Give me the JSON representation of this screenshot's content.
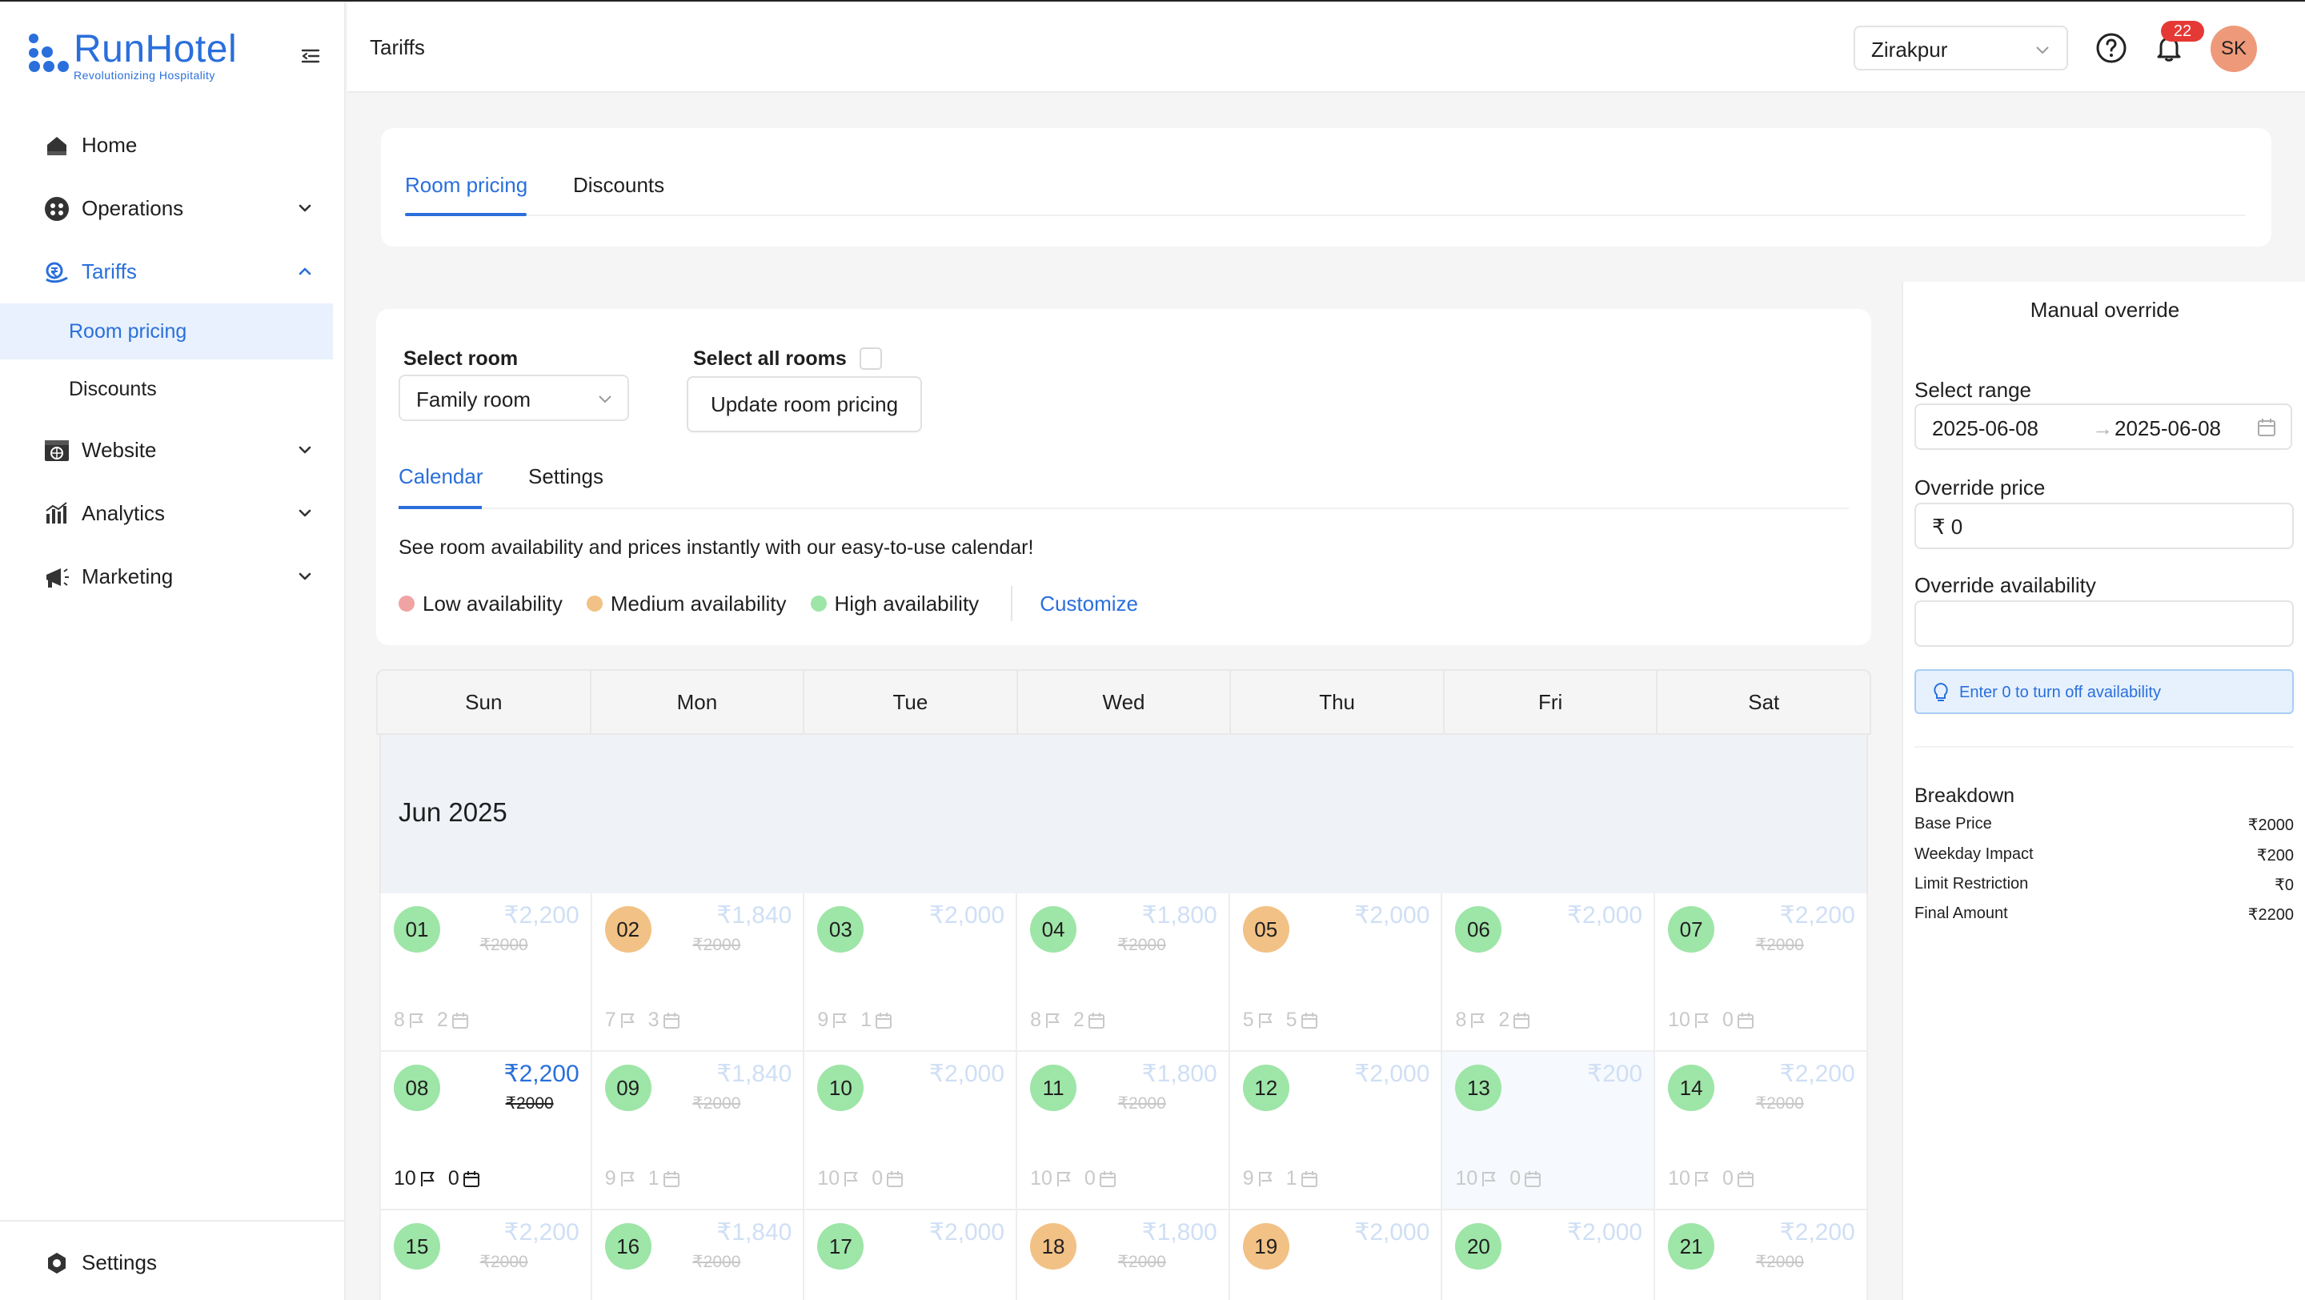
{
  "brand": {
    "name": "RunHotel",
    "tagline": "Revolutionizing Hospitality",
    "color": "#2a6fdb"
  },
  "sidebar": {
    "items": [
      {
        "label": "Home",
        "icon": "home-icon"
      },
      {
        "label": "Operations",
        "icon": "operations-icon",
        "expandable": true
      },
      {
        "label": "Tariffs",
        "icon": "tariffs-icon",
        "expanded": true,
        "active": true
      },
      {
        "label": "Website",
        "icon": "website-icon",
        "expandable": true
      },
      {
        "label": "Analytics",
        "icon": "analytics-icon",
        "expandable": true
      },
      {
        "label": "Marketing",
        "icon": "marketing-icon",
        "expandable": true
      }
    ],
    "sub_items": [
      {
        "label": "Room pricing",
        "selected": true
      },
      {
        "label": "Discounts"
      }
    ],
    "settings_label": "Settings"
  },
  "header": {
    "title": "Tariffs",
    "location": "Zirakpur",
    "notification_count": "22",
    "avatar_initials": "SK"
  },
  "main_tabs": [
    {
      "label": "Room pricing",
      "active": true
    },
    {
      "label": "Discounts"
    }
  ],
  "room": {
    "select_room_label": "Select room",
    "selected_room": "Family room",
    "select_all_label": "Select all rooms",
    "select_all_checked": false,
    "update_button": "Update room pricing",
    "tabs": [
      {
        "label": "Calendar",
        "active": true
      },
      {
        "label": "Settings"
      }
    ],
    "description": "See room availability and prices instantly with our easy-to-use calendar!",
    "legend": [
      {
        "label": "Low availability",
        "color": "#f0a3a3"
      },
      {
        "label": "Medium availability",
        "color": "#f2c185"
      },
      {
        "label": "High availability",
        "color": "#9ee5a8"
      }
    ],
    "customize_label": "Customize"
  },
  "calendar": {
    "weekdays": [
      "Sun",
      "Mon",
      "Tue",
      "Wed",
      "Thu",
      "Fri",
      "Sat"
    ],
    "month_label": "Jun 2025",
    "colors": {
      "green": "#9ee5a8",
      "orange": "#f2c185"
    },
    "weeks": [
      [
        {
          "day": "01",
          "level": "green",
          "price": "₹2,200",
          "base": "₹2000",
          "rooms": "8",
          "booked": "2"
        },
        {
          "day": "02",
          "level": "orange",
          "price": "₹1,840",
          "base": "₹2000",
          "rooms": "7",
          "booked": "3"
        },
        {
          "day": "03",
          "level": "green",
          "price": "₹2,000",
          "base": "",
          "rooms": "9",
          "booked": "1"
        },
        {
          "day": "04",
          "level": "green",
          "price": "₹1,800",
          "base": "₹2000",
          "rooms": "8",
          "booked": "2"
        },
        {
          "day": "05",
          "level": "orange",
          "price": "₹2,000",
          "base": "",
          "rooms": "5",
          "booked": "5"
        },
        {
          "day": "06",
          "level": "green",
          "price": "₹2,000",
          "base": "",
          "rooms": "8",
          "booked": "2"
        },
        {
          "day": "07",
          "level": "green",
          "price": "₹2,200",
          "base": "₹2000",
          "rooms": "10",
          "booked": "0"
        }
      ],
      [
        {
          "day": "08",
          "level": "green",
          "price": "₹2,200",
          "base": "₹2000",
          "rooms": "10",
          "booked": "0",
          "active": true
        },
        {
          "day": "09",
          "level": "green",
          "price": "₹1,840",
          "base": "₹2000",
          "rooms": "9",
          "booked": "1"
        },
        {
          "day": "10",
          "level": "green",
          "price": "₹2,000",
          "base": "",
          "rooms": "10",
          "booked": "0"
        },
        {
          "day": "11",
          "level": "green",
          "price": "₹1,800",
          "base": "₹2000",
          "rooms": "10",
          "booked": "0"
        },
        {
          "day": "12",
          "level": "green",
          "price": "₹2,000",
          "base": "",
          "rooms": "9",
          "booked": "1"
        },
        {
          "day": "13",
          "level": "green",
          "price": "₹200",
          "base": "",
          "rooms": "10",
          "booked": "0",
          "highlight": true
        },
        {
          "day": "14",
          "level": "green",
          "price": "₹2,200",
          "base": "₹2000",
          "rooms": "10",
          "booked": "0"
        }
      ],
      [
        {
          "day": "15",
          "level": "green",
          "price": "₹2,200",
          "base": "₹2000"
        },
        {
          "day": "16",
          "level": "green",
          "price": "₹1,840",
          "base": "₹2000"
        },
        {
          "day": "17",
          "level": "green",
          "price": "₹2,000",
          "base": ""
        },
        {
          "day": "18",
          "level": "orange",
          "price": "₹1,800",
          "base": "₹2000"
        },
        {
          "day": "19",
          "level": "orange",
          "price": "₹2,000",
          "base": ""
        },
        {
          "day": "20",
          "level": "green",
          "price": "₹2,000",
          "base": ""
        },
        {
          "day": "21",
          "level": "green",
          "price": "₹2,200",
          "base": "₹2000"
        }
      ]
    ]
  },
  "override": {
    "title": "Manual override",
    "range_label": "Select range",
    "start_date": "2025-06-08",
    "end_date": "2025-06-08",
    "price_label": "Override price",
    "price_value": "₹ 0",
    "availability_label": "Override availability",
    "availability_value": "",
    "info": "Enter 0 to turn off availability",
    "breakdown_title": "Breakdown",
    "breakdown": [
      {
        "label": "Base Price",
        "value": "₹2000"
      },
      {
        "label": "Weekday Impact",
        "value": "₹200"
      },
      {
        "label": "Limit Restriction",
        "value": "₹0"
      },
      {
        "label": "Final Amount",
        "value": "₹2200"
      }
    ]
  }
}
